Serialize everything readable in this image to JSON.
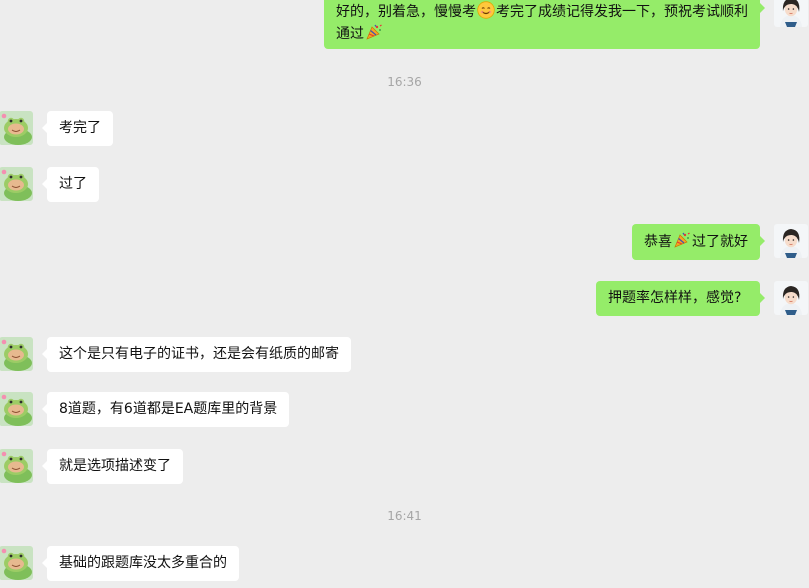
{
  "messages": [
    {
      "side": "out",
      "parts": [
        "好的，别着急，慢慢考",
        "考完了成绩记得发我一下，预祝考试顺利",
        "通过"
      ]
    },
    {
      "side": "in",
      "text": "考完了"
    },
    {
      "side": "in",
      "text": "过了"
    },
    {
      "side": "out",
      "parts": [
        "恭喜",
        "过了就好"
      ]
    },
    {
      "side": "out",
      "text": "押题率怎样样，感觉?"
    },
    {
      "side": "in",
      "text": "这个是只有电子的证书，还是会有纸质的邮寄"
    },
    {
      "side": "in",
      "text": "8道题，有6道都是EA题库里的背景"
    },
    {
      "side": "in",
      "text": "就是选项描述变了"
    },
    {
      "side": "in",
      "text": "基础的跟题库没太多重合的"
    }
  ],
  "timestamps": [
    "16:36",
    "16:41"
  ],
  "icons": {
    "smile": "smile-emoji-icon",
    "party": "party-popper-emoji-icon",
    "contact_avatar": "frog-avatar",
    "self_avatar": "woman-avatar"
  },
  "colors": {
    "background": "#ededed",
    "outgoing": "#95ec69",
    "incoming": "#ffffff",
    "timestamp": "#a6a6a6"
  }
}
